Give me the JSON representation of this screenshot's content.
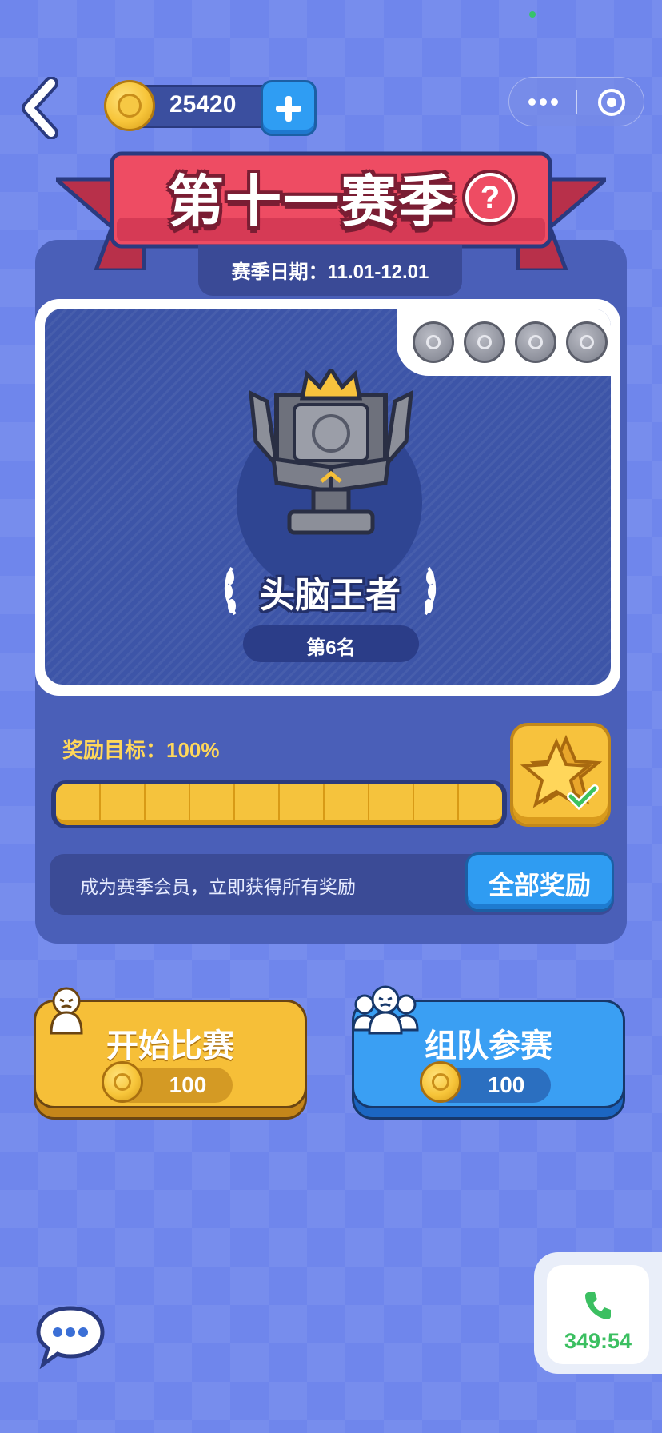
{
  "status": {
    "indicator_color": "#37c36a"
  },
  "header": {
    "coins": "25420",
    "back_icon": "chevron-left-icon",
    "add_coins_icon": "plus-icon",
    "menu_icon": "more-dots-icon",
    "close_icon": "target-circle-icon"
  },
  "season": {
    "title": "第十一赛季",
    "help_icon": "?",
    "date_label": "赛季日期：11.01-12.01"
  },
  "rank_card": {
    "badge_icons": [
      "badge-1-icon",
      "badge-2-icon",
      "badge-3-icon",
      "badge-4-icon"
    ],
    "trophy_icon": "brain-trophy-icon",
    "rank_title": "头脑王者",
    "rank_position": "第6名"
  },
  "reward": {
    "goal_label": "奖励目标：100%",
    "progress": 1.0,
    "segments": 10,
    "star_icon": "star-check-icon"
  },
  "vip": {
    "promo_text": "成为赛季会员，立即获得所有奖励",
    "all_rewards_label": "全部奖励"
  },
  "actions": {
    "start": {
      "label": "开始比赛",
      "cost": "100",
      "icon": "solo-player-icon"
    },
    "team": {
      "label": "组队参赛",
      "cost": "100",
      "icon": "team-players-icon"
    }
  },
  "floating": {
    "chat_icon": "chat-bubble-icon",
    "call_icon": "phone-icon",
    "call_time": "349:54"
  },
  "colors": {
    "background": "#6f86ec",
    "gold": "#f6bf38",
    "blue_button": "#3a9ff3",
    "banner_red": "#ee4c63",
    "call_green": "#3bbf61"
  }
}
